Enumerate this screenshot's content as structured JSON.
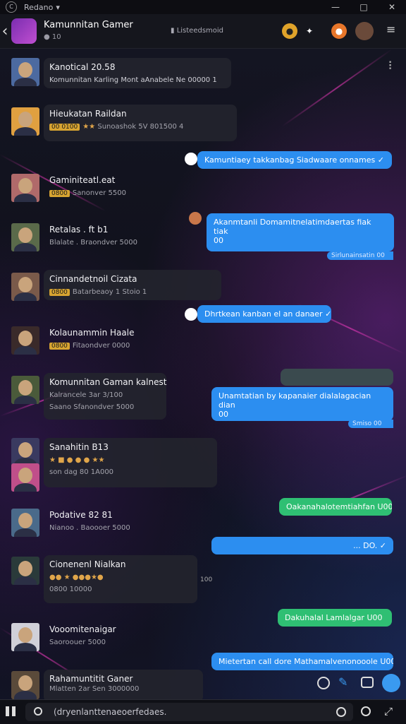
{
  "titlebar": {
    "app_name": "Redano",
    "dropdown": "▾",
    "minimize": "—",
    "maximize": "□",
    "close": "✕"
  },
  "header": {
    "back": "‹",
    "group_title": "Kamunnitan Gamer",
    "group_sub": "10",
    "center_label": "Listeedsmoid",
    "menu": "≡",
    "grid": "⠇"
  },
  "messages": [
    {
      "type": "left",
      "name": "Kanotical 20.58",
      "meta": "Komunnitan Karling Mont aAnabele Ne 00000 1"
    },
    {
      "type": "left",
      "name": "Hieukatan Raildan",
      "coin": "00 0100",
      "meta": "Sunoashok 5V 801500 4"
    },
    {
      "type": "right",
      "color": "blue",
      "text": "Kamuntiaey takkanbag Siadwaare onnames ✓"
    },
    {
      "type": "left",
      "name": "Gaminiteatl.eat",
      "coin": "0800",
      "meta": "Sanonver 5500"
    },
    {
      "type": "right",
      "color": "blue",
      "text": "Akanmtanli Domamitnelatimdaertas fiak tiak",
      "text2": "00",
      "meta": "Sirlunainsatin 00"
    },
    {
      "type": "left",
      "name": "Retalas . ft b1",
      "meta": "Blalate . Braondver 5000"
    },
    {
      "type": "left",
      "name": "Cinnandetnoil Cizata",
      "coin": "0800",
      "meta": "Batarbeaoy 1 Stoio 1"
    },
    {
      "type": "right",
      "color": "blue",
      "text": "Dhrtkean kanban el an danaer ✓"
    },
    {
      "type": "left",
      "name": "Kolaunammin Haale",
      "coin": "0800",
      "meta": "Fitaondver 0000"
    },
    {
      "type": "left",
      "name": "Komunnitan Gaman kalnest",
      "meta": "Kalrancele 3ar 3/100",
      "meta2": "Saano Sfanondver 5000"
    },
    {
      "type": "right",
      "color": "gray",
      "text": ""
    },
    {
      "type": "right",
      "color": "blue",
      "text": "Unamtatian by kapanaier dialalagacian dian",
      "text2": "00",
      "meta": "Smiso 00"
    },
    {
      "type": "left",
      "name": "Sanahitin B13",
      "meta": "son dag 80 1A000"
    },
    {
      "type": "right",
      "color": "green",
      "text": "Oakanahalotemtiahfan U00"
    },
    {
      "type": "left",
      "name": "Podative 82 81",
      "meta": "Nianoo . Baoooer 5000"
    },
    {
      "type": "right",
      "color": "blue",
      "text": "... DO. ✓"
    },
    {
      "type": "left",
      "name": "Cionenenl Nialkan",
      "meta": "0800 10000",
      "side": "100"
    },
    {
      "type": "right",
      "color": "green",
      "text": "Dakuhalal Lamlalgar U00"
    },
    {
      "type": "left",
      "name": "Vooomitenaigar",
      "meta": "Saoroouer 5000"
    },
    {
      "type": "right",
      "color": "blue",
      "text": "Mietertan call dore Mathamalvenonooole U00"
    },
    {
      "type": "left",
      "name": "Rahamuntitit Ganer",
      "meta": "Mlatten 2ar Sen 3000000"
    }
  ],
  "input": {
    "placeholder": "(dryenlanttenaeoerfedaes.",
    "value": ""
  },
  "colors": {
    "accent_blue": "#2c8ef0",
    "accent_green": "#2fbf73",
    "gold": "#d7a431"
  }
}
